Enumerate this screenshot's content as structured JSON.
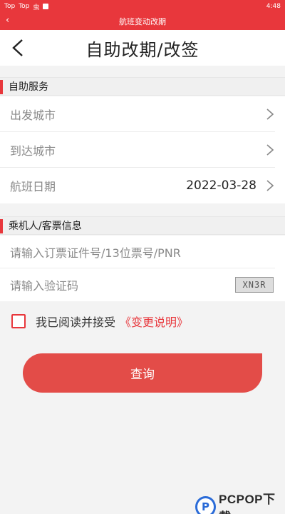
{
  "status_bar": {
    "left_items": [
      "Top",
      "Top",
      "虫"
    ],
    "time": "4:48"
  },
  "app_bar": {
    "title": "航班变动改期"
  },
  "page_header": {
    "title": "自助改期/改签"
  },
  "self_service": {
    "title": "自助服务",
    "rows": [
      {
        "label": "出发城市",
        "value": ""
      },
      {
        "label": "到达城市",
        "value": ""
      },
      {
        "label": "航班日期",
        "value": "2022-03-28"
      }
    ]
  },
  "passenger": {
    "title": "乘机人/客票信息",
    "ticket_placeholder": "请输入订票证件号/13位票号/PNR",
    "captcha_placeholder": "请输入验证码",
    "captcha_text": "XN3R"
  },
  "agreement": {
    "text": "我已阅读并接受",
    "link": "《变更说明》",
    "checked": false
  },
  "query_button": {
    "label": "查询"
  },
  "watermark": {
    "logo": "P",
    "text": "PCPOP下载"
  },
  "colors": {
    "accent": "#e8373c",
    "button": "#e34c48"
  }
}
